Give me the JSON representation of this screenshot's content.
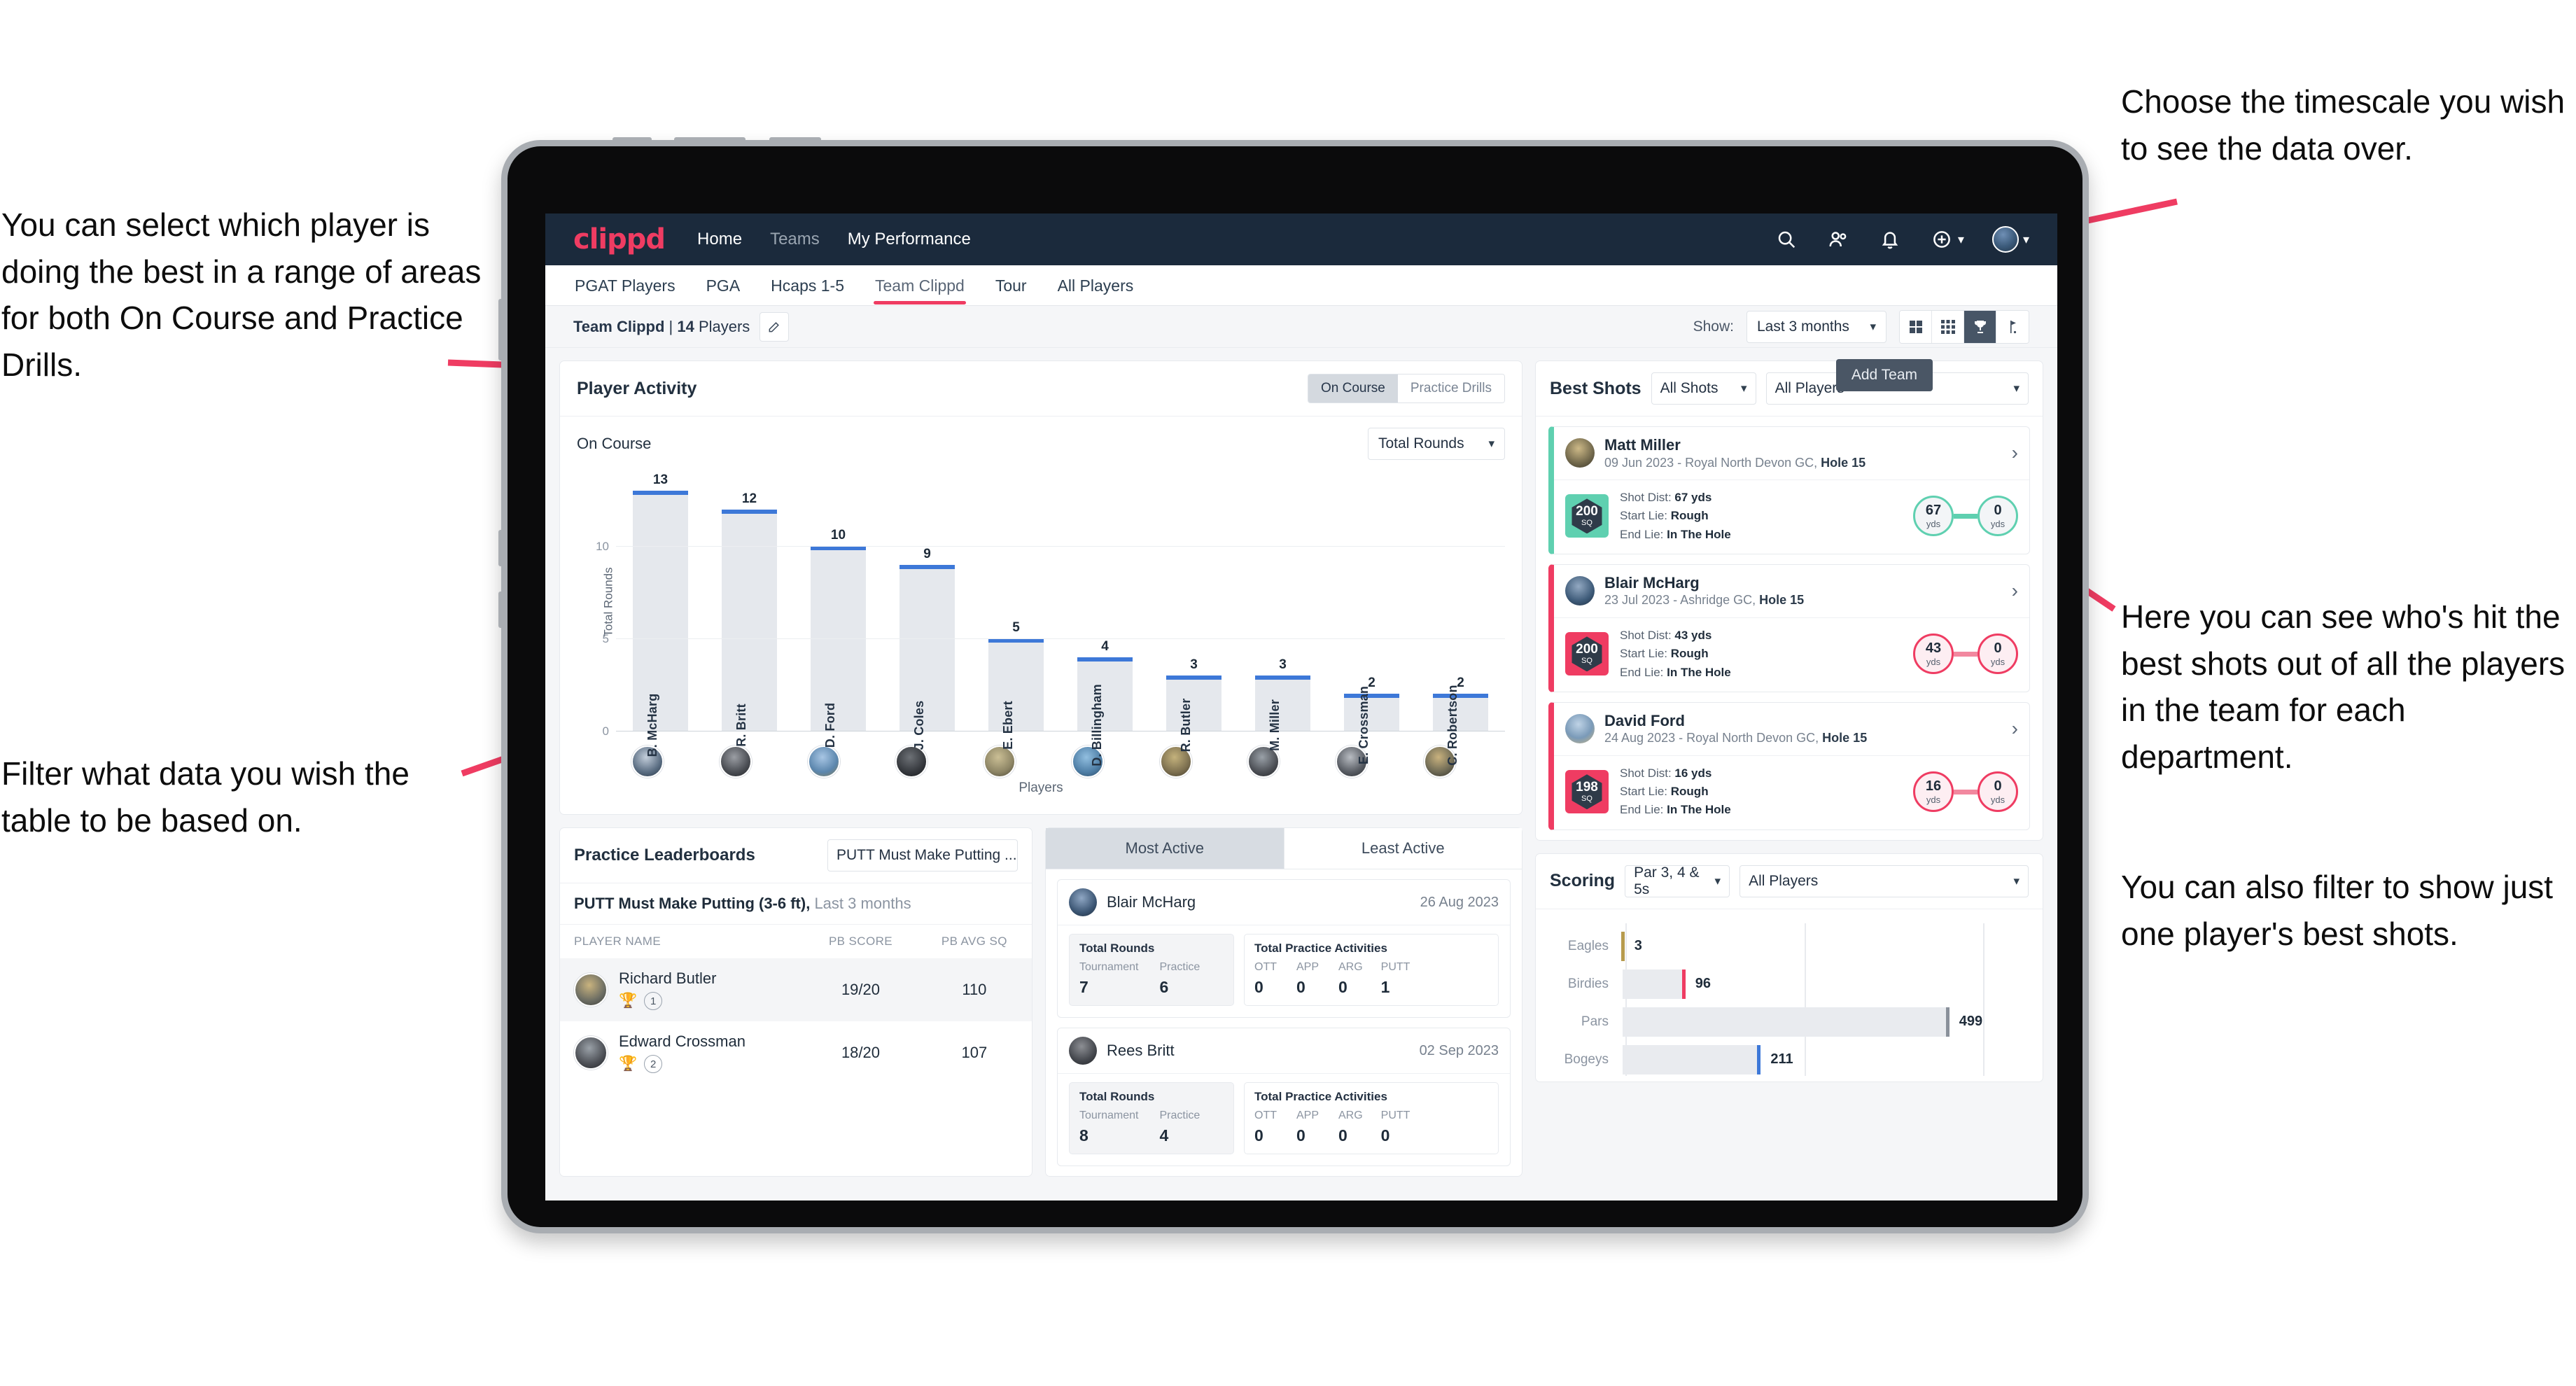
{
  "annotations": {
    "top_right": "Choose the timescale you wish to see the data over.",
    "top_left": "You can select which player is doing the best in a range of areas for both On Course and Practice Drills.",
    "right_mid": "Here you can see who's hit the best shots out of all the players in the team for each department.",
    "right_bottom": "You can also filter to show just one player's best shots.",
    "bottom_left": "Filter what data you wish the table to be based on."
  },
  "topnav": {
    "brand": "clippd",
    "links": [
      {
        "label": "Home",
        "dim": false
      },
      {
        "label": "Teams",
        "dim": true
      },
      {
        "label": "My Performance",
        "dim": false
      }
    ],
    "icons": [
      "search-icon",
      "people-icon",
      "bell-icon",
      "plus-circle-icon"
    ]
  },
  "tabs": [
    {
      "label": "PGAT Players",
      "active": false
    },
    {
      "label": "PGA",
      "active": false
    },
    {
      "label": "Hcaps 1-5",
      "active": false
    },
    {
      "label": "Team Clippd",
      "active": true
    },
    {
      "label": "Tour",
      "active": false
    },
    {
      "label": "All Players",
      "active": false
    }
  ],
  "toolbar": {
    "team_name": "Team Clippd",
    "separator": " | ",
    "player_count": "14",
    "players_word": " Players",
    "show_label": "Show:",
    "timescale_value": "Last 3 months",
    "tooltip_add_team": "Add Team",
    "view_icons": [
      "grid-4-icon",
      "grid-9-icon",
      "trophy-icon",
      "golf-flag-icon"
    ],
    "active_view_index": 2
  },
  "player_activity": {
    "title": "Player Activity",
    "segments": [
      {
        "label": "On Course",
        "active": true
      },
      {
        "label": "Practice Drills",
        "active": false
      }
    ],
    "sub_label": "On Course",
    "metric_value": "Total Rounds"
  },
  "chart_data": {
    "type": "bar",
    "title": "Player Activity",
    "xlabel": "Players",
    "ylabel": "Total Rounds",
    "ylim": [
      0,
      14
    ],
    "yticks": [
      0,
      5,
      10
    ],
    "grid": true,
    "categories": [
      "B. McHarg",
      "R. Britt",
      "D. Ford",
      "J. Coles",
      "E. Ebert",
      "D. Billingham",
      "R. Butler",
      "M. Miller",
      "E. Crossman",
      "C. Robertson"
    ],
    "values": [
      13,
      12,
      10,
      9,
      5,
      4,
      3,
      3,
      2,
      2
    ],
    "bar_color": "#e5e8ed",
    "cap_color": "#3d78d8"
  },
  "best_shots": {
    "title": "Best Shots",
    "filter_shots": "All Shots",
    "filter_players": "All Players",
    "shots": [
      {
        "player": "Matt Miller",
        "meta_prefix": "09 Jun 2023 - Royal North Devon GC, ",
        "hole": "Hole 15",
        "sq": "200",
        "sq_unit": "SQ",
        "accent": "#5fd0b0",
        "shot_dist_label": "Shot Dist: ",
        "shot_dist": "67 yds",
        "start_lie_label": "Start Lie: ",
        "start_lie": "Rough",
        "end_lie_label": "End Lie: ",
        "end_lie": "In The Hole",
        "from_num": "67",
        "from_unit": "yds",
        "to_num": "0",
        "to_unit": "yds"
      },
      {
        "player": "Blair McHarg",
        "meta_prefix": "23 Jul 2023 - Ashridge GC, ",
        "hole": "Hole 15",
        "sq": "200",
        "sq_unit": "SQ",
        "accent": "#ef3c62",
        "shot_dist_label": "Shot Dist: ",
        "shot_dist": "43 yds",
        "start_lie_label": "Start Lie: ",
        "start_lie": "Rough",
        "end_lie_label": "End Lie: ",
        "end_lie": "In The Hole",
        "from_num": "43",
        "from_unit": "yds",
        "to_num": "0",
        "to_unit": "yds"
      },
      {
        "player": "David Ford",
        "meta_prefix": "24 Aug 2023 - Royal North Devon GC, ",
        "hole": "Hole 15",
        "sq": "198",
        "sq_unit": "SQ",
        "accent": "#ef3c62",
        "shot_dist_label": "Shot Dist: ",
        "shot_dist": "16 yds",
        "start_lie_label": "Start Lie: ",
        "start_lie": "Rough",
        "end_lie_label": "End Lie: ",
        "end_lie": "In The Hole",
        "from_num": "16",
        "from_unit": "yds",
        "to_num": "0",
        "to_unit": "yds"
      }
    ]
  },
  "practice_leaderboards": {
    "title": "Practice Leaderboards",
    "select_value": "PUTT Must Make Putting ...",
    "subtitle_bold": "PUTT Must Make Putting (3-6 ft),",
    "subtitle_rest": " Last 3 months",
    "columns": [
      "PLAYER NAME",
      "PB SCORE",
      "PB AVG SQ"
    ],
    "rows": [
      {
        "name": "Richard Butler",
        "rank": "1",
        "trophy": "gold",
        "pb_score": "19/20",
        "pb_avg_sq": "110",
        "highlight": true
      },
      {
        "name": "Edward Crossman",
        "rank": "2",
        "trophy": "silver",
        "pb_score": "18/20",
        "pb_avg_sq": "107",
        "highlight": false
      }
    ]
  },
  "activity": {
    "tabs": [
      {
        "label": "Most Active",
        "active": true
      },
      {
        "label": "Least Active",
        "active": false
      }
    ],
    "rounds_title": "Total Rounds",
    "practice_title": "Total Practice Activities",
    "rounds_cols": [
      "Tournament",
      "Practice"
    ],
    "practice_cols": [
      "OTT",
      "APP",
      "ARG",
      "PUTT"
    ],
    "cards": [
      {
        "player": "Blair McHarg",
        "date": "26 Aug 2023",
        "tournament": "7",
        "practice": "6",
        "ott": "0",
        "app": "0",
        "arg": "0",
        "putt": "1"
      },
      {
        "player": "Rees Britt",
        "date": "02 Sep 2023",
        "tournament": "8",
        "practice": "4",
        "ott": "0",
        "app": "0",
        "arg": "0",
        "putt": "0"
      }
    ]
  },
  "scoring": {
    "title": "Scoring",
    "filter_par": "Par 3, 4 & 5s",
    "filter_players": "All Players",
    "chart": {
      "type": "bar",
      "orientation": "horizontal",
      "categories": [
        "Eagles",
        "Birdies",
        "Pars",
        "Bogeys"
      ],
      "values": [
        3,
        96,
        499,
        211
      ],
      "xlim": [
        0,
        620
      ],
      "cap_colors": [
        "#b79b4e",
        "#ef3c62",
        "#8a919b",
        "#3d78d8"
      ]
    }
  }
}
